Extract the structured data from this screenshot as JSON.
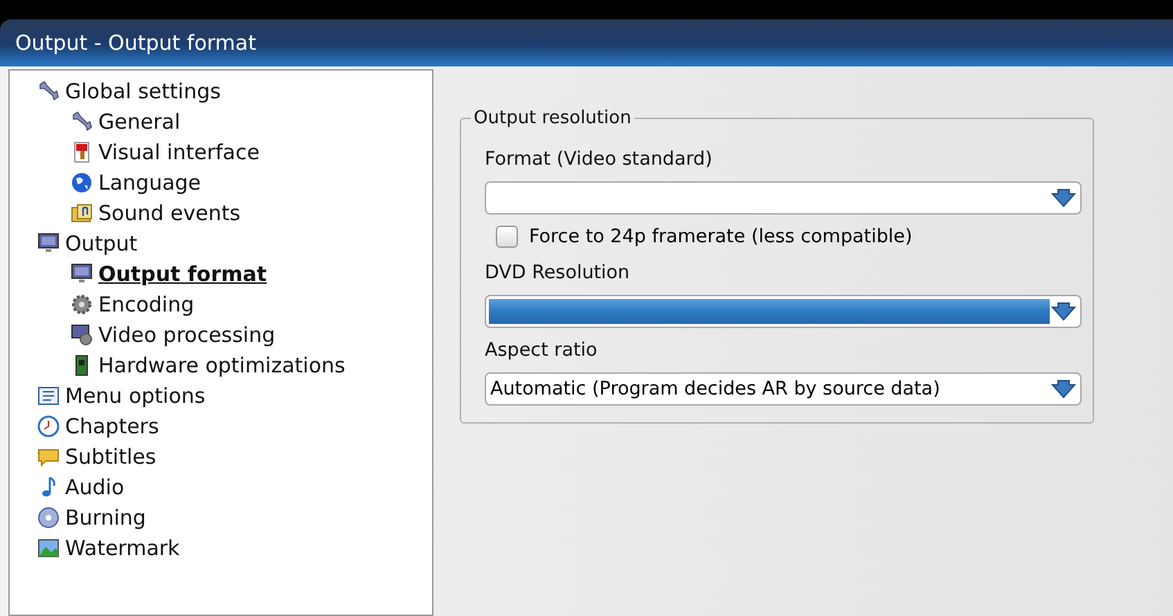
{
  "window": {
    "title": "Output - Output format"
  },
  "tree": [
    {
      "label": "Global settings",
      "selected": false,
      "children": [
        {
          "label": "General",
          "selected": false
        },
        {
          "label": "Visual interface",
          "selected": false
        },
        {
          "label": "Language",
          "selected": false
        },
        {
          "label": "Sound events",
          "selected": false
        }
      ]
    },
    {
      "label": "Output",
      "selected": false,
      "children": [
        {
          "label": "Output format",
          "selected": true
        },
        {
          "label": "Encoding",
          "selected": false
        },
        {
          "label": "Video processing",
          "selected": false
        },
        {
          "label": "Hardware optimizations",
          "selected": false
        }
      ]
    },
    {
      "label": "Menu options",
      "selected": false
    },
    {
      "label": "Chapters",
      "selected": false
    },
    {
      "label": "Subtitles",
      "selected": false
    },
    {
      "label": "Audio",
      "selected": false
    },
    {
      "label": "Burning",
      "selected": false
    },
    {
      "label": "Watermark",
      "selected": false
    }
  ],
  "group": {
    "title": "Output resolution",
    "fields": [
      {
        "kind": "dropdown",
        "label": "Format (Video standard)",
        "focused": false
      },
      {
        "kind": "checkbox",
        "label": "Force to 24p framerate (less compatible)",
        "checked": false
      },
      {
        "kind": "dropdown",
        "label": "DVD Resolution",
        "focused": true
      },
      {
        "kind": "dropdown",
        "label": "Aspect ratio",
        "value": "Automatic (Program decides AR by source data)",
        "focused": false
      }
    ]
  }
}
